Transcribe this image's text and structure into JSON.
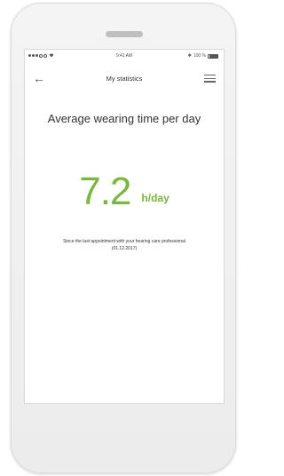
{
  "status_bar": {
    "carrier": "",
    "time": "9:41 AM",
    "battery_text": "100 %"
  },
  "nav": {
    "back_icon": "arrow-left-icon",
    "title": "My statistics",
    "menu_icon": "hamburger-menu-icon"
  },
  "stat": {
    "headline": "Average wearing time per day",
    "value": "7.2",
    "unit": "h/day",
    "caption": "Since the last appointment with your hearing care professional (01.12.2017)"
  },
  "colors": {
    "accent": "#7ab83a"
  }
}
